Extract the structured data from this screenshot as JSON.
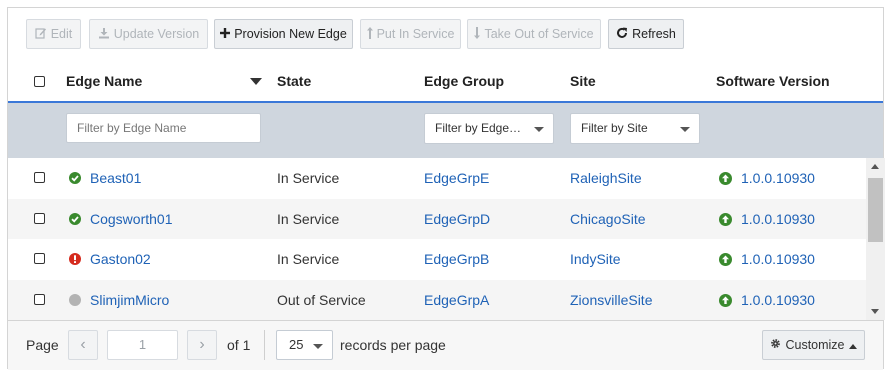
{
  "toolbar": {
    "edit": {
      "label": "Edit",
      "icon": "edit-icon",
      "enabled": false
    },
    "update_version": {
      "label": "Update Version",
      "icon": "download-icon",
      "enabled": false
    },
    "provision_new_edge": {
      "label": "Provision New Edge",
      "icon": "plus-icon",
      "enabled": true
    },
    "put_in_service": {
      "label": "Put In Service",
      "icon": "arrow-up-icon",
      "enabled": false
    },
    "take_out_of_service": {
      "label": "Take Out of Service",
      "icon": "arrow-down-icon",
      "enabled": false
    },
    "refresh": {
      "label": "Refresh",
      "icon": "refresh-icon",
      "enabled": true
    }
  },
  "table": {
    "columns": {
      "edge_name": "Edge Name",
      "state": "State",
      "edge_group": "Edge Group",
      "site": "Site",
      "software_version": "Software Version"
    },
    "sorted_column": "edge_name",
    "sort_direction": "descending"
  },
  "filters": {
    "edge_name_placeholder": "Filter by Edge Name",
    "edge_group_value": "Filter by Edge…",
    "site_value": "Filter by Site"
  },
  "rows": [
    {
      "name": "Beast01",
      "status": "ok",
      "state": "In Service",
      "edge_group": "EdgeGrpE",
      "site": "RaleighSite",
      "version": "1.0.0.10930"
    },
    {
      "name": "Cogsworth01",
      "status": "ok",
      "state": "In Service",
      "edge_group": "EdgeGrpD",
      "site": "ChicagoSite",
      "version": "1.0.0.10930"
    },
    {
      "name": "Gaston02",
      "status": "error",
      "state": "In Service",
      "edge_group": "EdgeGrpB",
      "site": "IndySite",
      "version": "1.0.0.10930"
    },
    {
      "name": "SlimjimMicro",
      "status": "offline",
      "state": "Out of Service",
      "edge_group": "EdgeGrpA",
      "site": "ZionsvilleSite",
      "version": "1.0.0.10930"
    }
  ],
  "pagination": {
    "page_label": "Page",
    "current_page": "1",
    "of_label": "of 1",
    "per_page_value": "25",
    "per_page_label": "records per page"
  },
  "customize": {
    "label": "Customize",
    "icon": "gear-icon"
  },
  "colors": {
    "link": "#1f62b6",
    "header_underline": "#3b78d8",
    "filter_row_bg": "#cfd6de",
    "status_ok": "#3a8a2e",
    "status_error": "#d52b1e",
    "status_offline": "#b3b3b3"
  }
}
